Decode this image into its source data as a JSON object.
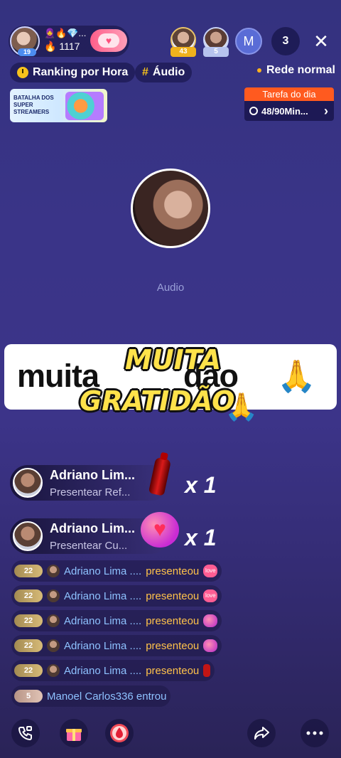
{
  "host": {
    "level": "19",
    "badges": "🧕🔥💎...",
    "heat_icon": "flame-icon",
    "heat_value": "1117",
    "follow_icon": "heart-icon"
  },
  "viewers": [
    {
      "badge": "43",
      "badge_color": "#f0b21d"
    },
    {
      "badge": "5",
      "badge_color": "#b7c3ee"
    }
  ],
  "viewer_initial": "M",
  "viewer_count": "3",
  "close_glyph": "✕",
  "tags": {
    "ranking": "Ranking por Hora",
    "hash": "#",
    "audio": "Áudio"
  },
  "network": "Rede normal",
  "banner": {
    "text": "BATALHA DOS SUPER STREAMERS"
  },
  "task": {
    "title": "Tarefa do dia",
    "progress": "48/90Min...",
    "chevron": "›"
  },
  "room": {
    "mode_label": "Audio"
  },
  "sticker": {
    "line_word1": "muita",
    "line_word2": "dão",
    "overlay_line1": "MUITA",
    "overlay_line2": "GRATIDÃO",
    "emoji": "🙏"
  },
  "gifts": [
    {
      "name": "Adriano Lim...",
      "action": "Presentear Ref...",
      "multiplier": "x 1",
      "gift_icon": "coke-bottle-icon"
    },
    {
      "name": "Adriano Lim...",
      "action": "Presentear Cu...",
      "multiplier": "x 1",
      "gift_icon": "heart-bubble-icon"
    }
  ],
  "chat": [
    {
      "level": "22",
      "name": "Adriano Lima ....",
      "verb": "presenteou",
      "icon": "love-icon",
      "icon_text": "love"
    },
    {
      "level": "22",
      "name": "Adriano Lima ....",
      "verb": "presenteou",
      "icon": "love-icon",
      "icon_text": "love"
    },
    {
      "level": "22",
      "name": "Adriano Lima ....",
      "verb": "presenteou",
      "icon": "heart-bubble-icon",
      "icon_text": ""
    },
    {
      "level": "22",
      "name": "Adriano Lima ....",
      "verb": "presenteou",
      "icon": "heart-bubble-icon",
      "icon_text": ""
    },
    {
      "level": "22",
      "name": "Adriano Lima ....",
      "verb": "presenteou",
      "icon": "coke-bottle-icon",
      "icon_text": ""
    }
  ],
  "join": {
    "level": "5",
    "text": "Manoel Carlos336 entrou"
  },
  "bottom": {
    "call_icon": "phone-video-icon",
    "gift_icon": "gift-box-icon",
    "drop_icon": "drop-icon",
    "share_icon": "share-arrow-icon",
    "more_icon": "more-dots-icon"
  },
  "colors": {
    "accent": "#ff5a1f",
    "name": "#8ec2ff",
    "verb": "#ffc24a",
    "sticker_text": "#ffe24a"
  }
}
